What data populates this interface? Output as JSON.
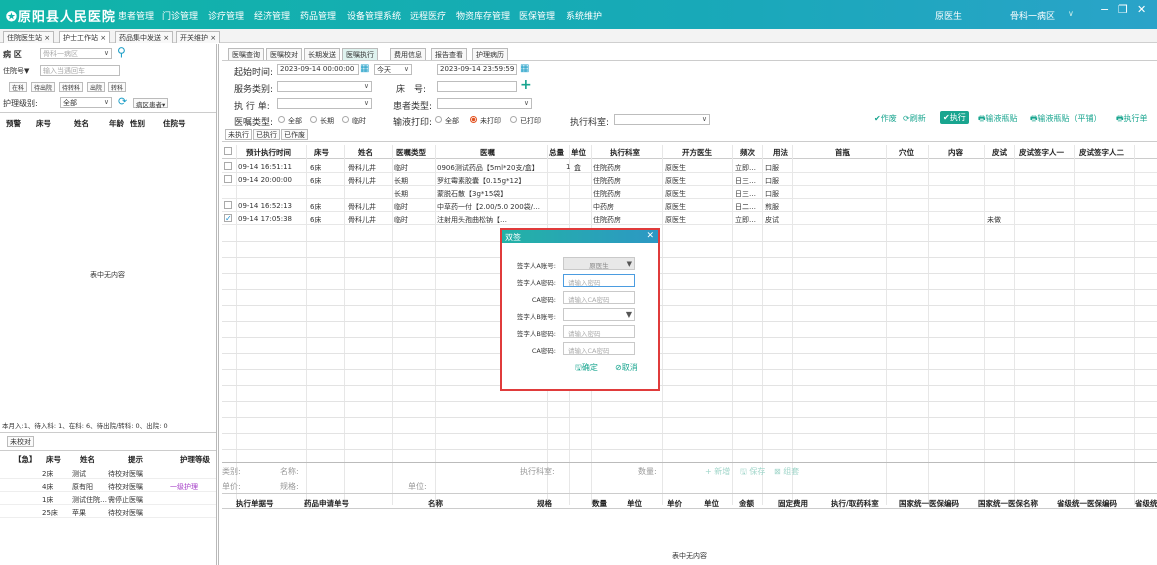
{
  "header": {
    "app_title": "✪原阳县人民医院",
    "menus": [
      "患者管理",
      "门诊管理",
      "诊疗管理",
      "经济管理",
      "药品管理",
      "设备管理系统",
      "远程医疗",
      "物资库存管理",
      "医保管理",
      "系统维护"
    ],
    "user": "原医生",
    "dept": "骨科一病区",
    "dept_arrow": "∨",
    "min": "−",
    "max": "❐",
    "close": "✕"
  },
  "tabs": [
    "住院医生站 ×",
    "护士工作站 ×",
    "药品集中发送 ×",
    "开关维护 ×"
  ],
  "left": {
    "ward_label": "病 区",
    "ward_value": "骨科一病区",
    "search_icon": "⚲",
    "inpatient_sel": "住院号▼",
    "inpatient_placeholder": "输入当遇回车",
    "status_tabs": [
      "在科",
      "待出院",
      "待转科",
      "出院",
      "转科"
    ],
    "care_level_label": "护理级别:",
    "care_level_value": "全部",
    "refresh_icon": "⟳",
    "ward_patients": "病区患者▾",
    "cols": [
      "预警",
      "床号",
      "姓名",
      "年龄",
      "性别",
      "住院号"
    ],
    "empty": "表中无内容",
    "summary": "本月入:1、待入科: 1、在科: 6、待出院/转科: 0、出院: 0",
    "uncheck_tab": "未校对",
    "task_cols": [
      "【急】",
      "床号",
      "姓名",
      "提示",
      "护理等级"
    ],
    "tasks": [
      {
        "bed": "2床",
        "name": "测试",
        "tip": "待校对医嘱",
        "level": ""
      },
      {
        "bed": "4床",
        "name": "原有阳",
        "tip": "待校对医嘱",
        "level": "一级护理"
      },
      {
        "bed": "1床",
        "name": "测试住院…",
        "tip": "需停止医嘱",
        "level": ""
      },
      {
        "bed": "25床",
        "name": "苹果",
        "tip": "待校对医嘱",
        "level": ""
      }
    ]
  },
  "main": {
    "subtabs": [
      "医嘱查询",
      "医嘱校对",
      "长期发送",
      "医嘱执行",
      "费用信息",
      "报告查看",
      "护理病历"
    ],
    "filters": {
      "start_label": "起始时间:",
      "start_value": "2023-09-14 00:00:00",
      "day_value": "今天",
      "end_value": "2023-09-14 23:59:59",
      "service_label": "服务类别:",
      "bed_label": "床　号:",
      "exec_label": "执 行 单:",
      "patient_type_label": "患者类型:",
      "order_type_label": "医嘱类型:",
      "order_type_opts": [
        "全部",
        "长期",
        "临时"
      ],
      "infusion_label": "输液打印:",
      "infusion_opts": [
        "全部",
        "未打印",
        "已打印"
      ],
      "dept_label": "执行科室:",
      "plus": "+",
      "calendar": "▦"
    },
    "toolbar": [
      "✔作废",
      "⟳刷新",
      "✔执行",
      "🖶输液瓶贴",
      "🖶输液瓶贴（平铺）",
      "🖶执行单"
    ],
    "status_tabs": [
      "未执行",
      "已执行",
      "已作废"
    ],
    "grid_cols": [
      "预计执行时间",
      "床号",
      "姓名",
      "医嘱类型",
      "医嘱",
      "总量",
      "单位",
      "执行科室",
      "开方医生",
      "频次",
      "用法",
      "首瓶",
      "穴位",
      "内容",
      "皮试",
      "皮试签字人一",
      "皮试签字人二"
    ],
    "rows": [
      {
        "time": "09-14 16:51:11",
        "bed": "6床",
        "name": "骨科儿井",
        "type": "临时",
        "order": "0906测试药品【5ml*20支/盒】",
        "total": "1",
        "unit": "盒",
        "dept": "住院药房",
        "doc": "原医生",
        "freq": "立即…",
        "use": "口服",
        "skin": "",
        "checked": false,
        "showbox": true
      },
      {
        "time": "09-14 20:00:00",
        "bed": "6床",
        "name": "骨科儿井",
        "type": "长期",
        "order": "罗红霉素胶囊【0.15g*12】",
        "total": "",
        "unit": "",
        "dept": "住院药房",
        "doc": "原医生",
        "freq": "日三…",
        "use": "口服",
        "skin": "",
        "checked": false,
        "showbox": true
      },
      {
        "time": "",
        "bed": "",
        "name": "",
        "type": "长期",
        "order": "蒙脱石散【3g*15袋】",
        "total": "",
        "unit": "",
        "dept": "住院药房",
        "doc": "原医生",
        "freq": "日三…",
        "use": "口服",
        "skin": "",
        "checked": false,
        "showbox": false
      },
      {
        "time": "09-14 16:52:13",
        "bed": "6床",
        "name": "骨科儿井",
        "type": "临时",
        "order": "中草药一付【2.00/5.0 200袋/…",
        "total": "",
        "unit": "",
        "dept": "中药房",
        "doc": "原医生",
        "freq": "日二…",
        "use": "煎服",
        "skin": "",
        "checked": false,
        "showbox": true
      },
      {
        "time": "09-14 17:05:38",
        "bed": "6床",
        "name": "骨科儿井",
        "type": "临时",
        "order": "注射用头孢曲松钠【…",
        "total": "",
        "unit": "",
        "dept": "住院药房",
        "doc": "原医生",
        "freq": "立即…",
        "use": "皮试",
        "skin": "未做",
        "checked": true,
        "showbox": true
      }
    ],
    "detail": {
      "row1": [
        "类别:",
        "名称:",
        "执行科室:",
        "数量:"
      ],
      "row2": [
        "单价:",
        "规格:",
        "单位:"
      ],
      "add": "+ 新增",
      "save": "🖫 保存",
      "group": "⊠ 组套",
      "cols": [
        "执行单据号",
        "药品申请单号",
        "名称",
        "规格",
        "数量",
        "单位",
        "单价",
        "单位",
        "金额",
        "固定费用",
        "执行/取药科室",
        "国家统一医保编码",
        "国家统一医保名称",
        "省级统一医保编码",
        "省级统"
      ],
      "empty": "表中无内容"
    }
  },
  "dialog": {
    "title": "双签",
    "close": "✕",
    "fields": [
      {
        "label": "签字人A账号:",
        "value": "原医生",
        "type": "select-disabled"
      },
      {
        "label": "签字人A密码:",
        "value": "请输入密码",
        "type": "input-focus"
      },
      {
        "label": "CA密码:",
        "value": "请输入CA密码",
        "type": "input"
      },
      {
        "label": "签字人B账号:",
        "value": "",
        "type": "select"
      },
      {
        "label": "签字人B密码:",
        "value": "请输入密码",
        "type": "input"
      },
      {
        "label": "CA密码:",
        "value": "请输入CA密码",
        "type": "input"
      }
    ],
    "confirm": "🖫确定",
    "cancel": "⊘取消"
  },
  "colors": {
    "accent": "#19a58f",
    "topbar": "#10b4a8",
    "dialog_border": "#e03b3b",
    "warn_text": "#a43cc7"
  }
}
